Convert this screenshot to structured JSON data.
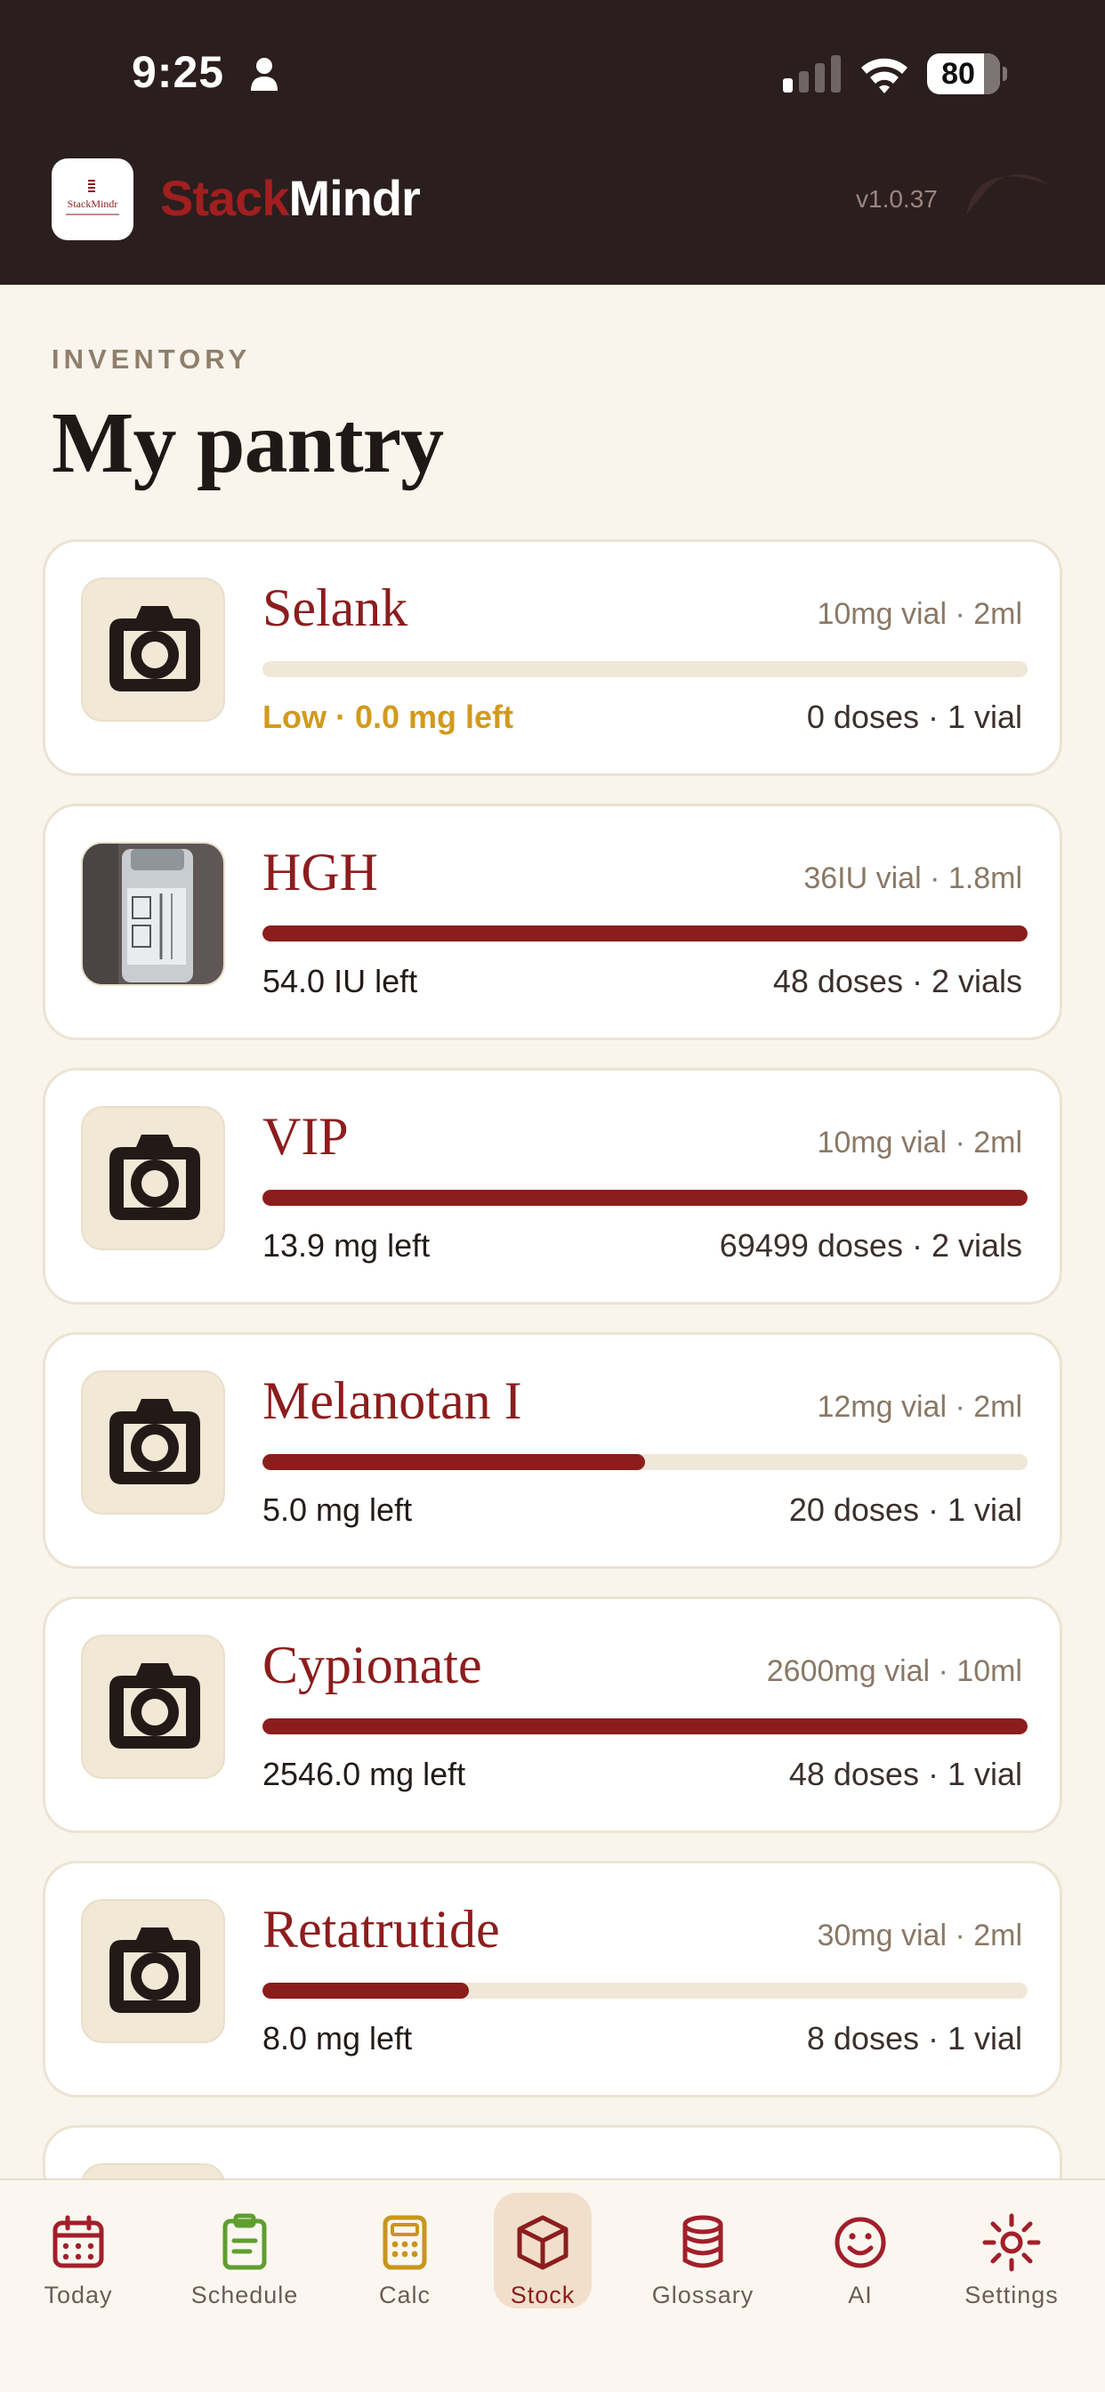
{
  "status_bar": {
    "time": "9:25",
    "battery": "80"
  },
  "header": {
    "logo_text": "StackMindr",
    "brand_part1": "Stack",
    "brand_part2": "Mindr",
    "version": "v1.0.37"
  },
  "page": {
    "eyebrow": "INVENTORY",
    "title": "My pantry"
  },
  "items": [
    {
      "name": "Selank",
      "spec": "10mg vial · 2ml",
      "remaining": "Low · 0.0 mg left",
      "doses": "0 doses · 1 vial",
      "level": 0.0,
      "low": true,
      "photo": "camera-icon"
    },
    {
      "name": "HGH",
      "spec": "36IU vial · 1.8ml",
      "remaining": "54.0 IU left",
      "doses": "48 doses · 2 vials",
      "level": 1.0,
      "low": false,
      "photo": "vial-photo"
    },
    {
      "name": "VIP",
      "spec": "10mg vial · 2ml",
      "remaining": "13.9 mg left",
      "doses": "69499 doses · 2 vials",
      "level": 1.0,
      "low": false,
      "photo": "camera-icon"
    },
    {
      "name": "Melanotan I",
      "spec": "12mg vial · 2ml",
      "remaining": "5.0 mg left",
      "doses": "20 doses · 1 vial",
      "level": 0.5,
      "low": false,
      "photo": "camera-icon"
    },
    {
      "name": "Cypionate",
      "spec": "2600mg vial · 10ml",
      "remaining": "2546.0 mg left",
      "doses": "48 doses · 1 vial",
      "level": 1.0,
      "low": false,
      "photo": "camera-icon"
    },
    {
      "name": "Retatrutide",
      "spec": "30mg vial · 2ml",
      "remaining": "8.0 mg left",
      "doses": "8 doses · 1 vial",
      "level": 0.27,
      "low": false,
      "photo": "camera-icon"
    }
  ],
  "nav": [
    {
      "label": "Today",
      "icon": "calendar-icon",
      "color": "#a11f2a"
    },
    {
      "label": "Schedule",
      "icon": "clipboard-icon",
      "color": "#5f9e2f"
    },
    {
      "label": "Calc",
      "icon": "calculator-icon",
      "color": "#c9951d"
    },
    {
      "label": "Stock",
      "icon": "box-icon",
      "color": "#8c1d1d",
      "active": true
    },
    {
      "label": "Glossary",
      "icon": "database-icon",
      "color": "#a11f2a"
    },
    {
      "label": "AI",
      "icon": "smiley-icon",
      "color": "#a11f2a"
    },
    {
      "label": "Settings",
      "icon": "sun-gear-icon",
      "color": "#a11f2a"
    }
  ],
  "colors": {
    "accent": "#8c1d1d",
    "low": "#d29a1c",
    "header_bg": "#2b1e1e",
    "page_bg": "#f9f4ec"
  }
}
